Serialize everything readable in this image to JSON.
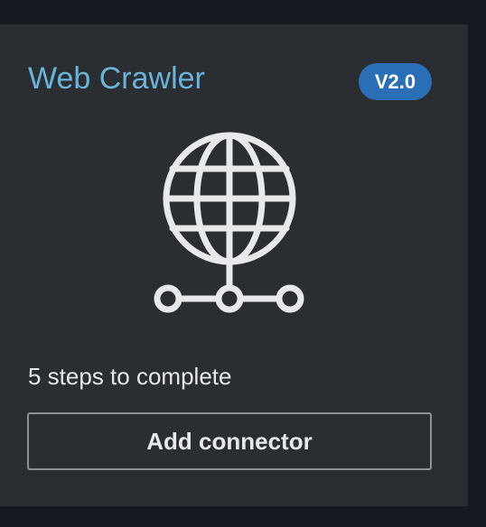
{
  "card": {
    "title": "Web Crawler",
    "version_badge": "V2.0",
    "icon": "globe-network-icon",
    "steps_text": "5 steps to complete",
    "add_button_label": "Add connector"
  },
  "colors": {
    "page_background": "#16191f",
    "card_background": "#2a2e33",
    "title": "#6ab4d8",
    "badge": "#2a6fb6",
    "text": "#e8e9ea",
    "button_border": "#8d9196"
  }
}
